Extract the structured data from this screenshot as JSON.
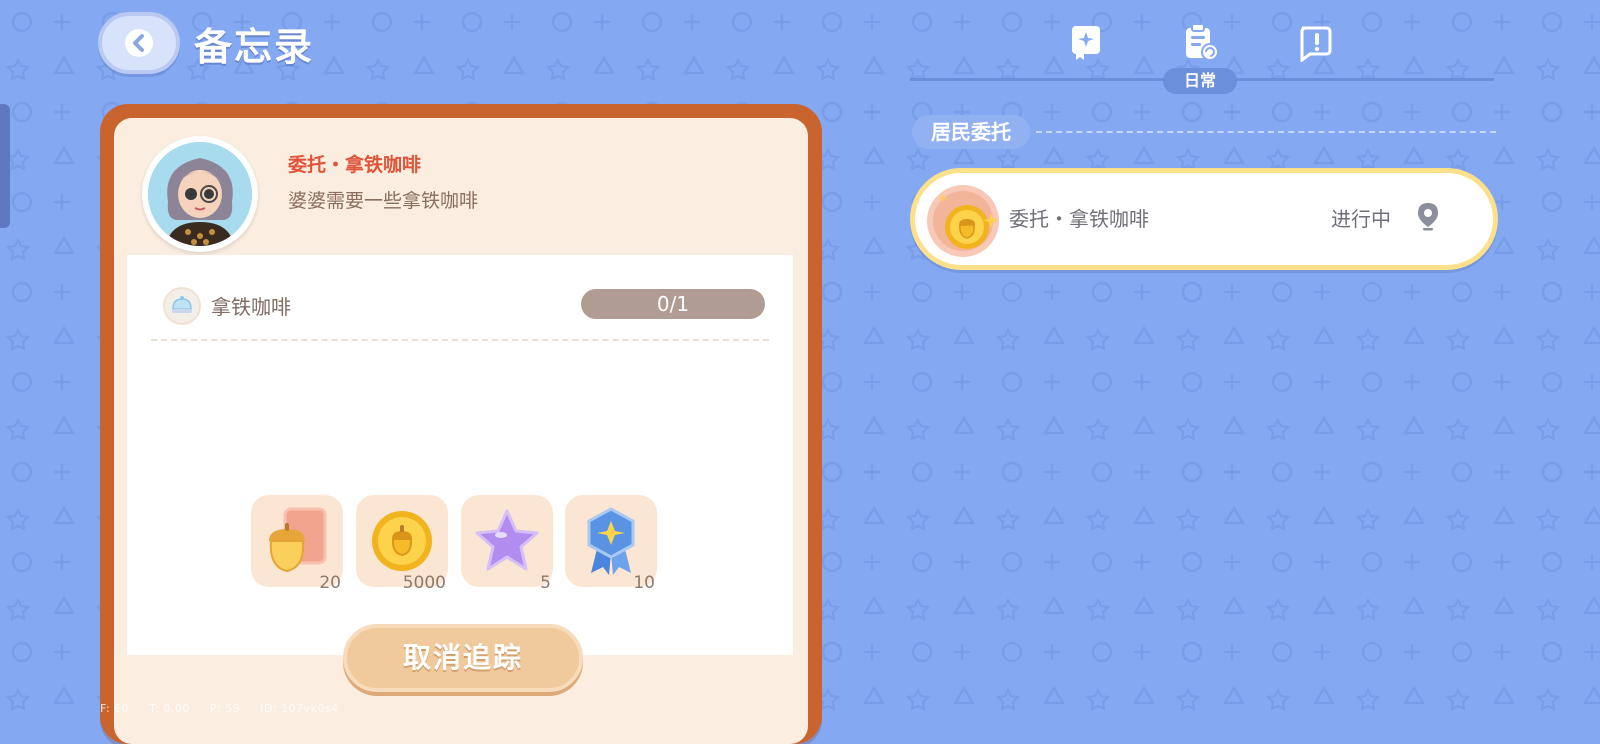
{
  "header": {
    "title": "备忘录",
    "back_icon": "chevron-left-icon"
  },
  "tabs": [
    {
      "icon": "story-book-icon",
      "label": "",
      "active": false
    },
    {
      "icon": "daily-clipboard-icon",
      "label": "日常",
      "active": true
    },
    {
      "icon": "exclamation-note-icon",
      "label": "",
      "active": false
    }
  ],
  "detail": {
    "title": "委托・拿铁咖啡",
    "description": "婆婆需要一些拿铁咖啡",
    "requirement": {
      "name": "拿铁咖啡",
      "progress": "0/1",
      "current": 0,
      "total": 1
    },
    "rewards": [
      {
        "icon": "acorn-card-icon",
        "count": "20"
      },
      {
        "icon": "gold-coin-icon",
        "count": "5000"
      },
      {
        "icon": "purple-star-icon",
        "count": "5"
      },
      {
        "icon": "blue-badge-icon",
        "count": "10"
      }
    ],
    "cancel_label": "取消追踪"
  },
  "section": {
    "label": "居民委托"
  },
  "task_list": [
    {
      "title": "委托・拿铁咖啡",
      "status": "进行中",
      "icon": "gold-coin-icon"
    }
  ],
  "debug": {
    "f": "F: 60",
    "t": "T: 0.00",
    "p": "P: 59",
    "id": "ID: 107vk0s4"
  },
  "colors": {
    "background": "#84a8f2",
    "frame": "#c9642f",
    "title_red": "#e0543a",
    "highlight": "#fde08a"
  }
}
